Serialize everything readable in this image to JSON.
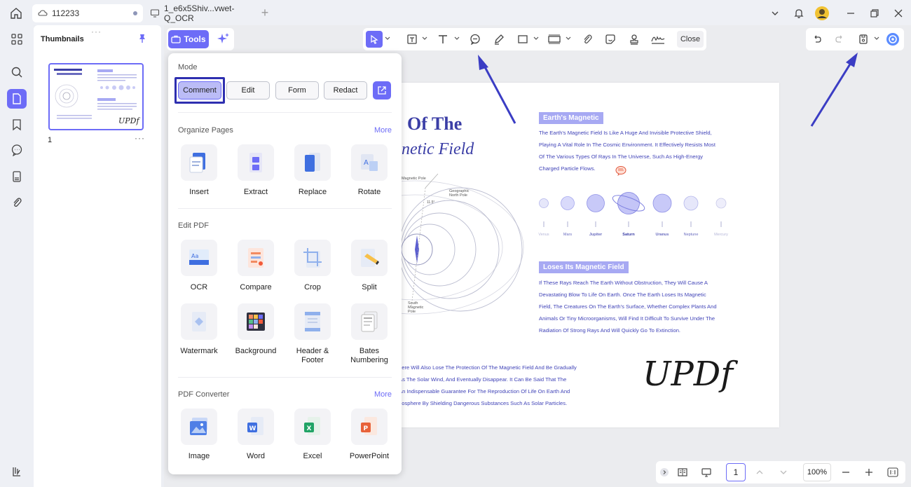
{
  "tabs": [
    {
      "label": "112233"
    },
    {
      "label": "1_e6x5Shiv...vwet-Q_OCR"
    }
  ],
  "thumbnails": {
    "title": "Thumbnails",
    "page_number": "1",
    "more": "···",
    "handle": "···"
  },
  "tools_button": {
    "label": "Tools"
  },
  "toolbar": {
    "close_label": "Close"
  },
  "popup": {
    "mode_title": "Mode",
    "modes": [
      "Comment",
      "Edit",
      "Form",
      "Redact"
    ],
    "organize_title": "Organize Pages",
    "organize_more": "More",
    "organize": [
      "Insert",
      "Extract",
      "Replace",
      "Rotate"
    ],
    "edit_title": "Edit PDF",
    "edit": [
      "OCR",
      "Compare",
      "Crop",
      "Split",
      "Watermark",
      "Background",
      "Header & Footer",
      "Bates Numbering"
    ],
    "converter_title": "PDF Converter",
    "converter_more": "More",
    "converter": [
      "Image",
      "Word",
      "Excel",
      "PowerPoint"
    ]
  },
  "pdf": {
    "title_line1": "Of The",
    "title_line2": "gnetic Field",
    "h1": "Earth's Magnetic",
    "p1": [
      "The Earth's Magnetic Field Is Like A Huge And Invisible Protective Shield,",
      "Playing A Vital Role In The Cosmic Environment. It Effectively Resists Most",
      "Of The Various Types Of Rays In The Universe, Such As High-Energy",
      "Charged Particle Flows."
    ],
    "planets": [
      "Venus",
      "Mars",
      "Jupiter",
      "Saturn",
      "Uranus",
      "Neptune",
      "Mercury"
    ],
    "h2": "Loses Its Magnetic Field",
    "p2": [
      "If These Rays Reach The Earth Without Obstruction, They Will Cause A",
      "Devastating Blow To Life On Earth. Once The Earth Loses Its Magnetic",
      "Field, The Creatures On The Earth's Surface, Whether Complex Plants And",
      "Animals Or Tiny Microorganisms, Will Find It Difficult To Survive Under The",
      "Radiation Of Strong Rays And Will Quickly Go To Extinction."
    ],
    "p3": [
      "here Will Also Lose The Protection Of The Magnetic Field And Be Gradually",
      "As The Solar Wind, And Eventually Disappear. It Can Be Said That The",
      "An Indispensable Guarantee For The Reproduction Of Life On Earth And",
      "nosphere By Shielding Dangerous Substances Such As Solar Particles."
    ],
    "diagram_labels": {
      "north_geographic": "Geographic North Pole",
      "north_magnetic": "rth Magnetic Pole",
      "south_magnetic": "South Magnetic Pole",
      "angle": "11.5°"
    },
    "signature": "UPDf"
  },
  "bottom": {
    "page": "1",
    "zoom": "100%"
  },
  "colors": {
    "accent": "#6d6cf7",
    "pdf_text": "#4144b8",
    "highlight": "#2e2fb0",
    "arrow": "#3b3dc4"
  }
}
